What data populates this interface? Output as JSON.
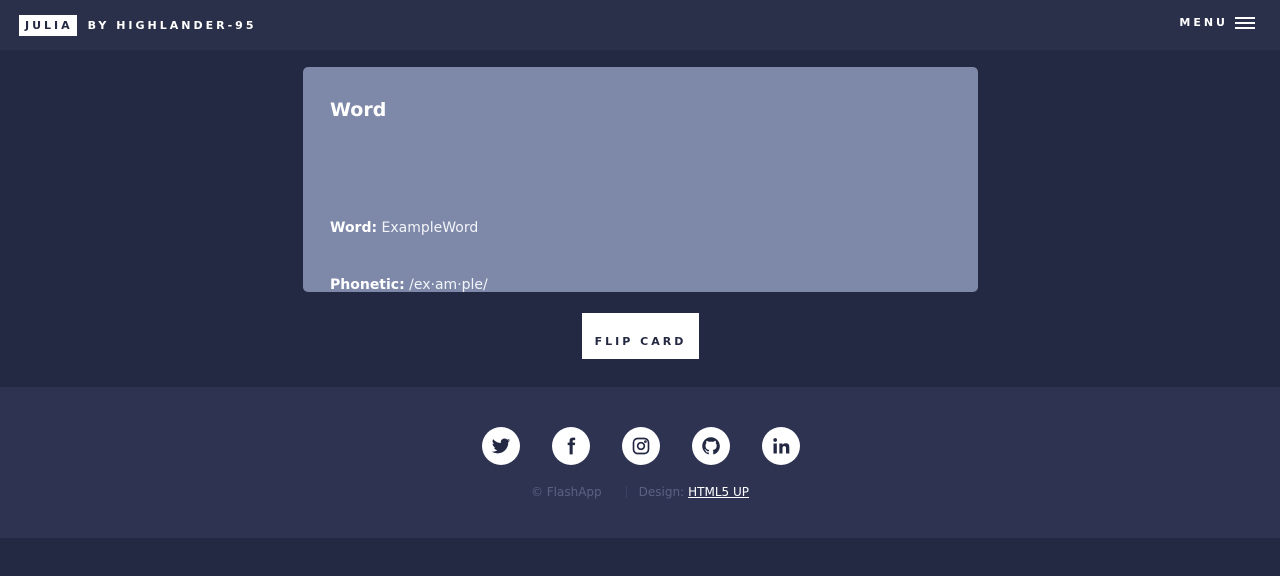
{
  "header": {
    "logo_box": "JULIA",
    "logo_rest": "BY HIGHLANDER-95",
    "menu_label": "MENU"
  },
  "card": {
    "title": "Word",
    "word_label": "Word:",
    "word_value": "ExampleWord",
    "phonetic_label": "Phonetic:",
    "phonetic_value": "/ex·am·ple/"
  },
  "flip_button": "FLIP CARD",
  "footer": {
    "social_icons": [
      "twitter-icon",
      "facebook-icon",
      "instagram-icon",
      "github-icon",
      "linkedin-icon"
    ],
    "copyright": "© FlashApp",
    "design_label": "Design:",
    "design_link": "HTML5 UP"
  },
  "colors": {
    "background": "#242943",
    "card": "#7e89a9",
    "footer": "#2e3352",
    "text": "#ffffff"
  }
}
